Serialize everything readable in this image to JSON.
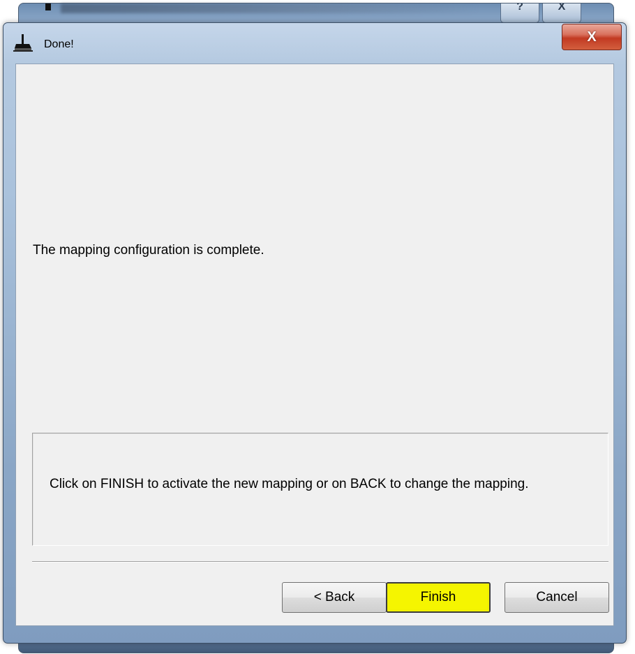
{
  "parent_window": {
    "help_glyph": "?",
    "close_glyph": "X"
  },
  "dialog": {
    "title": "Done!",
    "title_icon": "app-icon",
    "close_glyph": "X",
    "message": "The mapping configuration is complete.",
    "info": "Click on FINISH to activate the new mapping or on BACK to change the mapping.",
    "buttons": {
      "back": "< Back",
      "finish": "Finish",
      "cancel": "Cancel"
    },
    "colors": {
      "finish_highlight": "#f5f500",
      "close_button": "#c23a22"
    }
  }
}
